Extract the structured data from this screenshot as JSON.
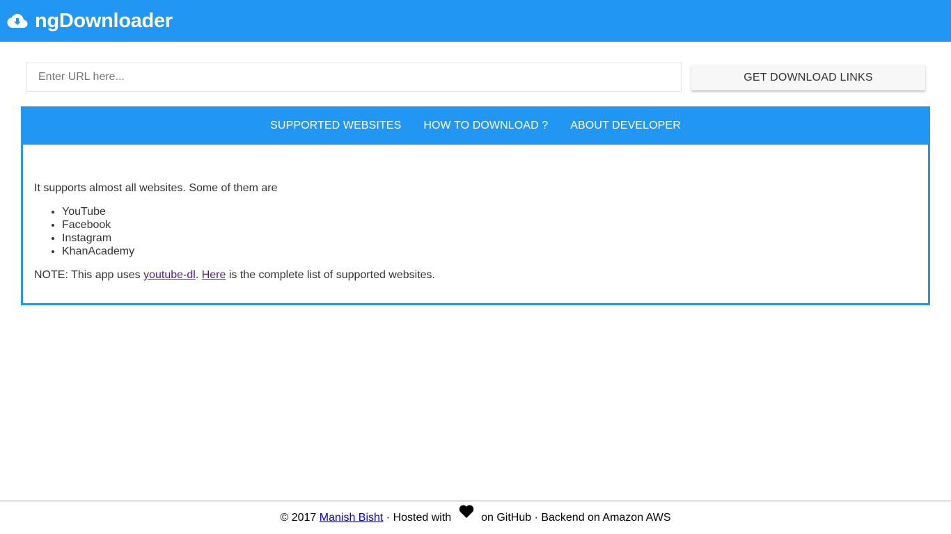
{
  "header": {
    "title": "ngDownloader",
    "logo_icon": "cloud-download-icon"
  },
  "search": {
    "placeholder": "Enter URL here...",
    "value": "",
    "button_label": "GET DOWNLOAD LINKS"
  },
  "tabs": [
    {
      "label": "SUPPORTED WEBSITES",
      "active": true
    },
    {
      "label": "HOW TO DOWNLOAD ?",
      "active": false
    },
    {
      "label": "ABOUT DEVELOPER",
      "active": false
    }
  ],
  "content": {
    "intro": "It supports almost all websites. Some of them are",
    "sites": [
      "YouTube",
      "Facebook",
      "Instagram",
      "KhanAcademy"
    ],
    "note_prefix": "NOTE: This app uses ",
    "note_link1": "youtube-dl",
    "note_mid": ". ",
    "note_link2": "Here",
    "note_suffix": " is the complete list of supported websites."
  },
  "footer": {
    "copyright": "© 2017 ",
    "author": "Manish Bisht",
    "hosted": " · Hosted with ",
    "heart_icon": "heart-icon",
    "github": " on GitHub · Backend on Amazon AWS"
  },
  "colors": {
    "primary": "#2196f3",
    "text": "#333333",
    "visited_link": "#551a8b",
    "link": "#0000ee"
  }
}
